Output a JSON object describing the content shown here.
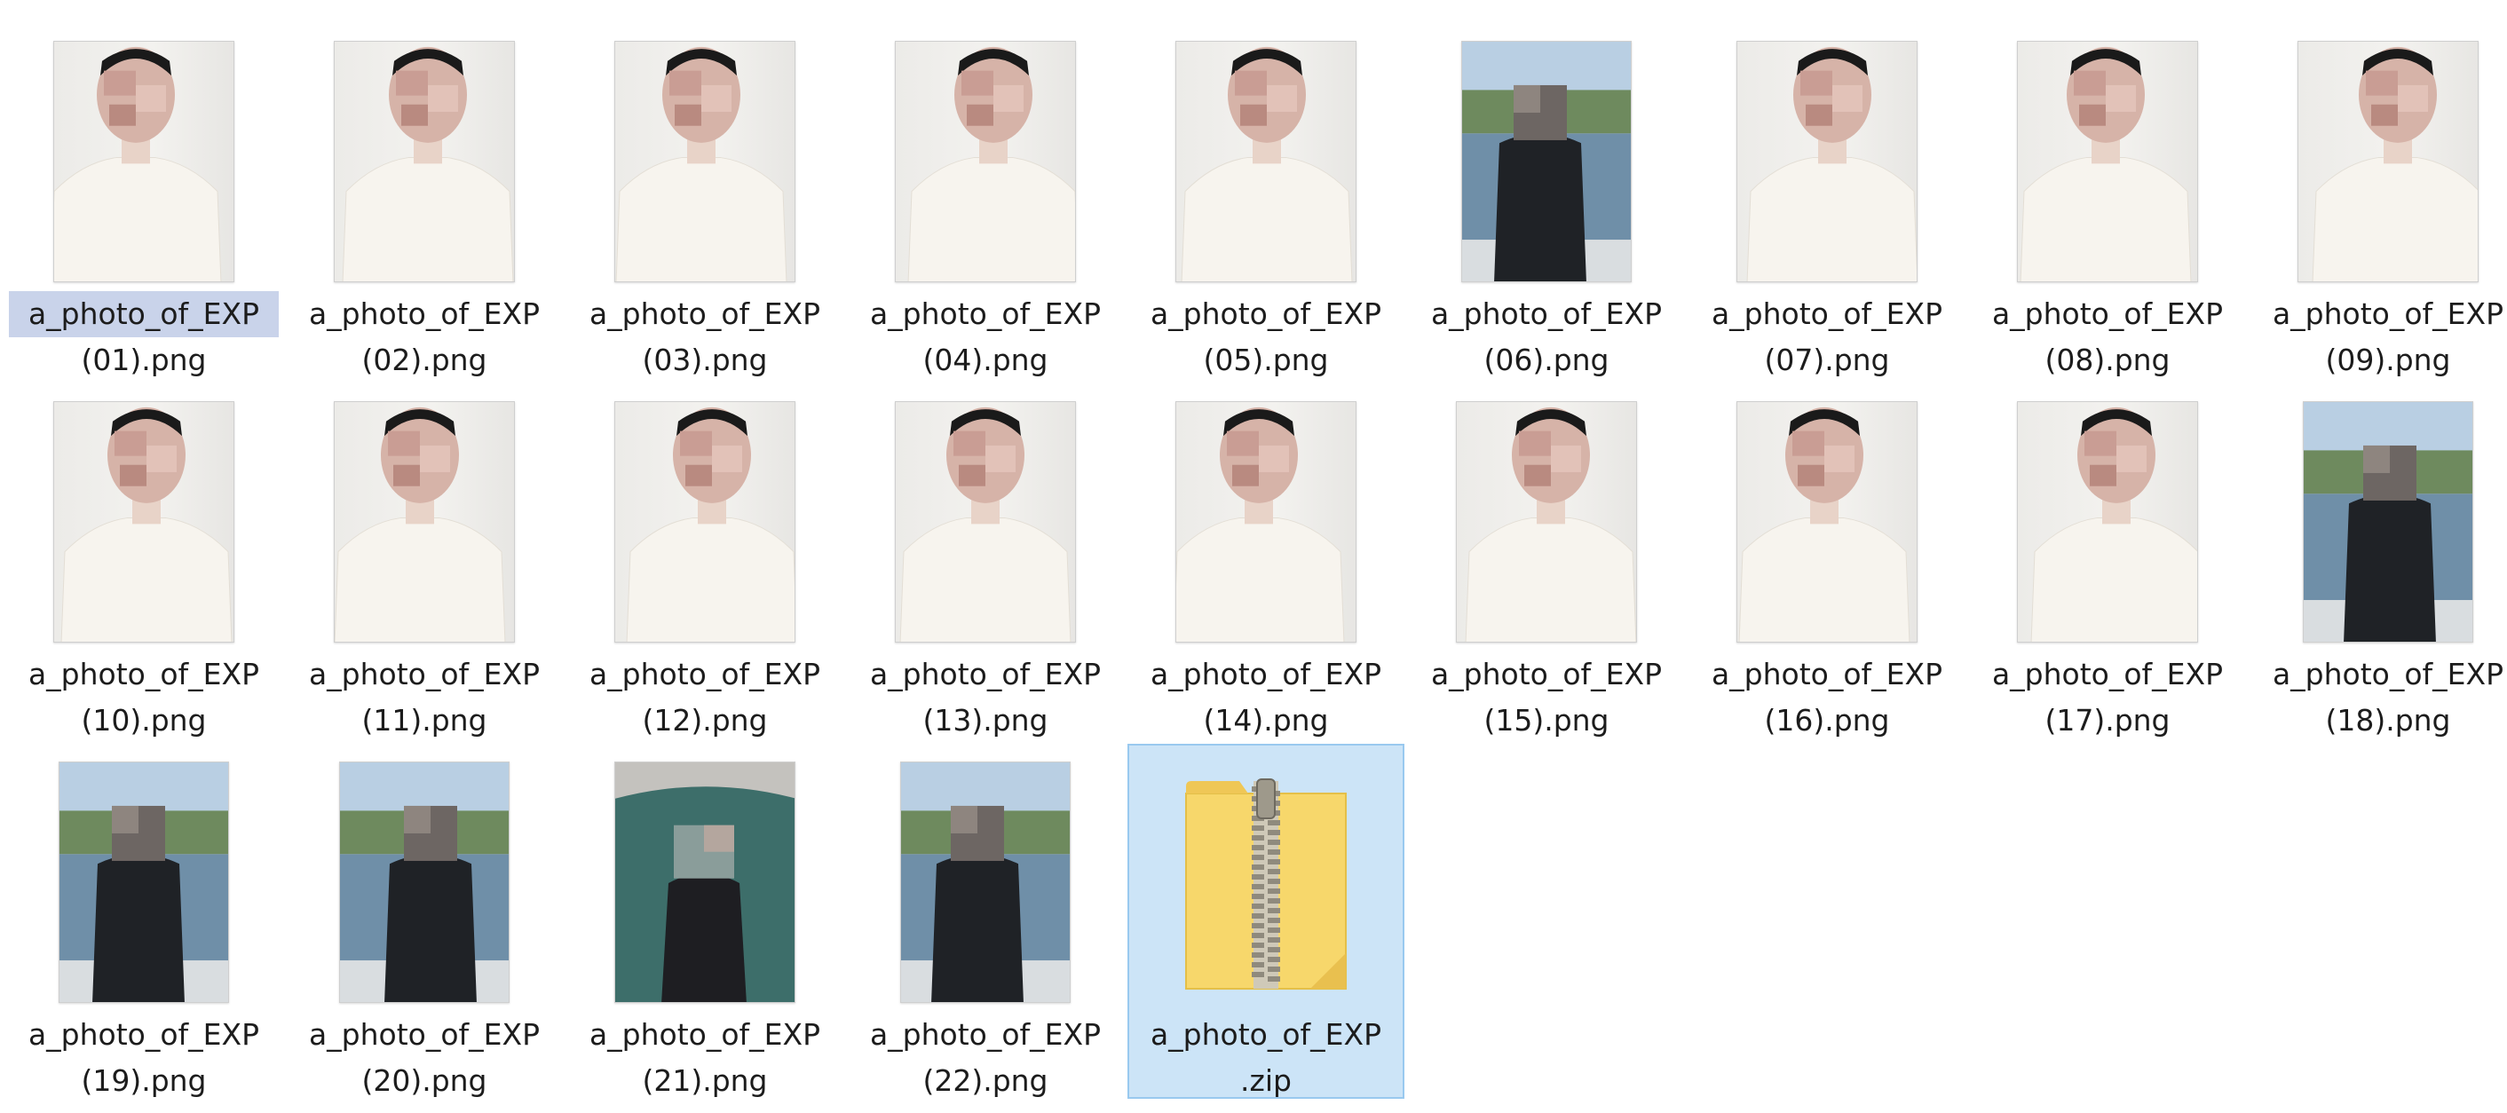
{
  "files": [
    {
      "line1": "a_photo_of_EXP",
      "line2": "(01).png",
      "kind": "studio",
      "state": "focused",
      "icon": "image-thumbnail"
    },
    {
      "line1": "a_photo_of_EXP",
      "line2": "(02).png",
      "kind": "studio",
      "state": "normal",
      "icon": "image-thumbnail"
    },
    {
      "line1": "a_photo_of_EXP",
      "line2": "(03).png",
      "kind": "studio",
      "state": "normal",
      "icon": "image-thumbnail"
    },
    {
      "line1": "a_photo_of_EXP",
      "line2": "(04).png",
      "kind": "studio",
      "state": "normal",
      "icon": "image-thumbnail"
    },
    {
      "line1": "a_photo_of_EXP",
      "line2": "(05).png",
      "kind": "studio",
      "state": "normal",
      "icon": "image-thumbnail"
    },
    {
      "line1": "a_photo_of_EXP",
      "line2": "(06).png",
      "kind": "outdoor",
      "state": "normal",
      "icon": "image-thumbnail"
    },
    {
      "line1": "a_photo_of_EXP",
      "line2": "(07).png",
      "kind": "studio",
      "state": "normal",
      "icon": "image-thumbnail"
    },
    {
      "line1": "a_photo_of_EXP",
      "line2": "(08).png",
      "kind": "studio",
      "state": "normal",
      "icon": "image-thumbnail"
    },
    {
      "line1": "a_photo_of_EXP",
      "line2": "(09).png",
      "kind": "studio",
      "state": "normal",
      "icon": "image-thumbnail"
    },
    {
      "line1": "a_photo_of_EXP",
      "line2": "(10).png",
      "kind": "studio",
      "state": "normal",
      "icon": "image-thumbnail"
    },
    {
      "line1": "a_photo_of_EXP",
      "line2": "(11).png",
      "kind": "studio",
      "state": "normal",
      "icon": "image-thumbnail"
    },
    {
      "line1": "a_photo_of_EXP",
      "line2": "(12).png",
      "kind": "studio",
      "state": "normal",
      "icon": "image-thumbnail"
    },
    {
      "line1": "a_photo_of_EXP",
      "line2": "(13).png",
      "kind": "studio",
      "state": "normal",
      "icon": "image-thumbnail"
    },
    {
      "line1": "a_photo_of_EXP",
      "line2": "(14).png",
      "kind": "studio",
      "state": "normal",
      "icon": "image-thumbnail"
    },
    {
      "line1": "a_photo_of_EXP",
      "line2": "(15).png",
      "kind": "studio",
      "state": "normal",
      "icon": "image-thumbnail"
    },
    {
      "line1": "a_photo_of_EXP",
      "line2": "(16).png",
      "kind": "studio",
      "state": "normal",
      "icon": "image-thumbnail"
    },
    {
      "line1": "a_photo_of_EXP",
      "line2": "(17).png",
      "kind": "studio",
      "state": "normal",
      "icon": "image-thumbnail"
    },
    {
      "line1": "a_photo_of_EXP",
      "line2": "(18).png",
      "kind": "outdoor",
      "state": "normal",
      "icon": "image-thumbnail"
    },
    {
      "line1": "a_photo_of_EXP",
      "line2": "(19).png",
      "kind": "outdoor",
      "state": "normal",
      "icon": "image-thumbnail"
    },
    {
      "line1": "a_photo_of_EXP",
      "line2": "(20).png",
      "kind": "outdoor",
      "state": "normal",
      "icon": "image-thumbnail"
    },
    {
      "line1": "a_photo_of_EXP",
      "line2": "(21).png",
      "kind": "lounge",
      "state": "normal",
      "icon": "image-thumbnail"
    },
    {
      "line1": "a_photo_of_EXP",
      "line2": "(22).png",
      "kind": "outdoor",
      "state": "normal",
      "icon": "image-thumbnail"
    },
    {
      "line1": "a_photo_of_EXP",
      "line2": ".zip",
      "kind": "zip",
      "state": "selected",
      "icon": "zip-folder"
    }
  ],
  "colors": {
    "selection_fill": "#cce4f7",
    "selection_border": "#99c9ef",
    "focus_label_fill": "#c9d3ea",
    "zip_folder": "#f7d76b",
    "label_text": "#1c1c1c"
  }
}
